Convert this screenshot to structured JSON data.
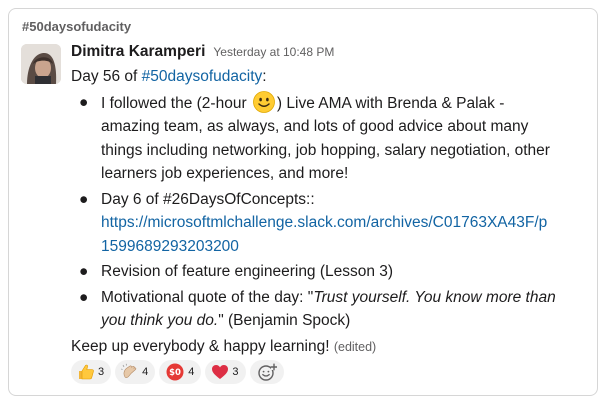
{
  "channel": {
    "name": "#50daysofudacity"
  },
  "message": {
    "sender": "Dimitra Karamperi",
    "timestamp": "Yesterday at 10:48 PM",
    "intro_prefix": "Day 56 of ",
    "intro_hashtag": "#50daysofudacity",
    "intro_suffix": ":",
    "bullet_glyph": "●",
    "items": [
      {
        "text_before_emoji": "I followed the (2-hour ",
        "emoji": "slightly-smiling-face-icon",
        "text_after_emoji_line1": ") Live AMA with Brenda & Palak -",
        "line2": "amazing team, as always, and lots of good advice about many",
        "line3": "things including networking, job hopping, salary negotiation, other",
        "line4": "learners job experiences, and more!"
      },
      {
        "line1": "Day 6 of #26DaysOfConcepts::",
        "link_line1": "https://microsoftmlchallenge.slack.com/archives/C01763XA43F/p",
        "link_line2": "1599689293203200"
      },
      {
        "line1": "Revision of feature engineering (Lesson 3)"
      },
      {
        "prefix": "Motivational quote of the day: \"",
        "quote_line1": "Trust yourself. You know more than",
        "quote_line2": "you think you do.",
        "suffix": "\" (Benjamin Spock)"
      }
    ],
    "closing": "Keep up everybody & happy learning! ",
    "edited_label": "(edited)"
  },
  "reactions": [
    {
      "icon": "thumbs-up-icon",
      "count": "3"
    },
    {
      "icon": "clapping-hands-icon",
      "count": "4"
    },
    {
      "icon": "hundred-points-icon",
      "count": "4"
    },
    {
      "icon": "red-heart-icon",
      "count": "3"
    }
  ],
  "colors": {
    "link": "#1264a3",
    "text": "#1d1c1d",
    "muted": "#616061",
    "reaction_bg": "#f1f1f1"
  }
}
